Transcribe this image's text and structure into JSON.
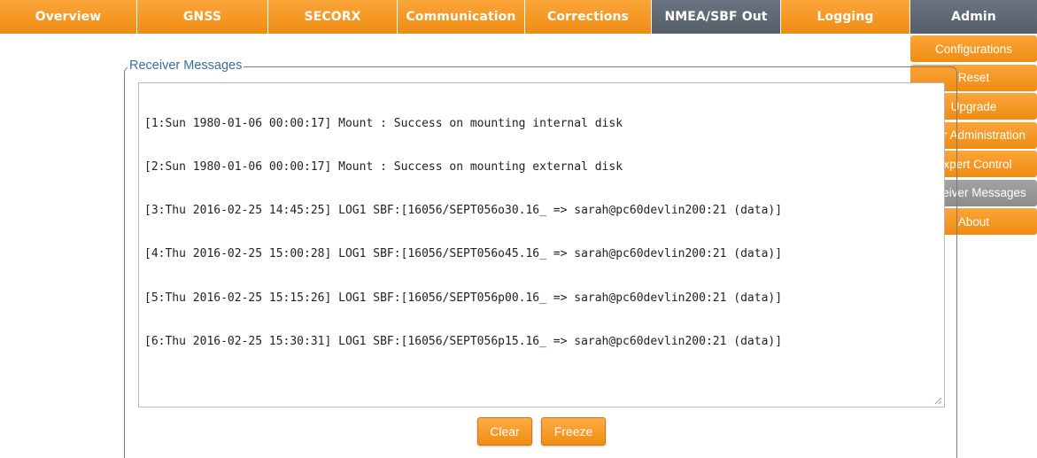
{
  "nav": {
    "tabs": [
      {
        "label": "Overview"
      },
      {
        "label": "GNSS"
      },
      {
        "label": "SECORX"
      },
      {
        "label": "Communication"
      },
      {
        "label": "Corrections"
      },
      {
        "label": "NMEA/SBF Out"
      },
      {
        "label": "Logging"
      },
      {
        "label": "Admin"
      }
    ]
  },
  "admin_menu": {
    "items": [
      {
        "label": "Configurations"
      },
      {
        "label": "Reset"
      },
      {
        "label": "Upgrade"
      },
      {
        "label": "User Administration"
      },
      {
        "label": "Expert Control"
      },
      {
        "label": "Receiver Messages"
      },
      {
        "label": "About"
      }
    ]
  },
  "panel": {
    "legend": "Receiver Messages",
    "messages": [
      "[1:Sun 1980-01-06 00:00:17] Mount : Success on mounting internal disk",
      "[2:Sun 1980-01-06 00:00:17] Mount : Success on mounting external disk",
      "[3:Thu 2016-02-25 14:45:25] LOG1 SBF:[16056/SEPT056o30.16_ => sarah@pc60devlin200:21 (data)]",
      "[4:Thu 2016-02-25 15:00:28] LOG1 SBF:[16056/SEPT056o45.16_ => sarah@pc60devlin200:21 (data)]",
      "[5:Thu 2016-02-25 15:15:26] LOG1 SBF:[16056/SEPT056p00.16_ => sarah@pc60devlin200:21 (data)]",
      "[6:Thu 2016-02-25 15:30:31] LOG1 SBF:[16056/SEPT056p15.16_ => sarah@pc60devlin200:21 (data)]"
    ]
  },
  "buttons": {
    "clear_label": "Clear",
    "freeze_label": "Freeze"
  },
  "colors": {
    "accent_orange": "#f7941d",
    "active_tab_gray": "#5f6873",
    "selected_menu_gray": "#999999",
    "legend_blue": "#3b6e9e"
  },
  "icons": {
    "resize_grip": "resize-grip-icon"
  }
}
